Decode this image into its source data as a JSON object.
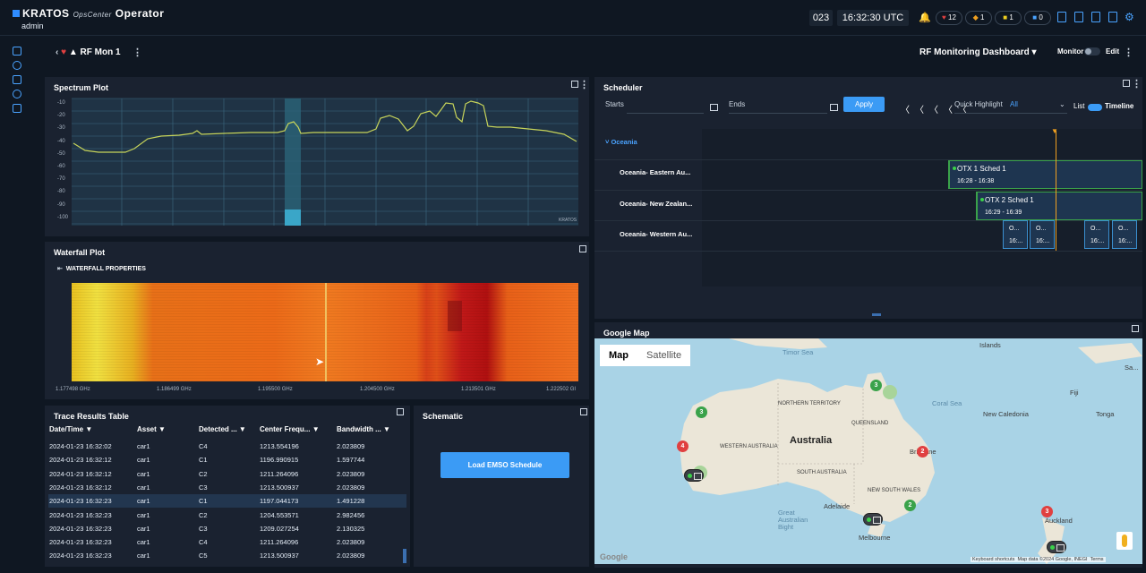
{
  "header": {
    "brand": "KRATOS",
    "product": "OpsCenter",
    "product_suffix": "Operator",
    "user": "admin",
    "counter": "023",
    "clock": "16:32:30 UTC",
    "alarms": [
      {
        "label": "12",
        "color": "#e04040"
      },
      {
        "label": "1",
        "color": "#f0a020"
      },
      {
        "label": "1",
        "color": "#f0d020"
      },
      {
        "label": "0",
        "color": "#4aa3ff"
      }
    ]
  },
  "subheader": {
    "breadcrumb": "RF Mon 1",
    "dashboard_select": "RF Monitoring Dashboard",
    "monitor_label": "Monitor",
    "edit_label": "Edit"
  },
  "spectrum": {
    "title": "Spectrum Plot",
    "y_ticks": [
      "-10",
      "-20",
      "-30",
      "-40",
      "-50",
      "-60",
      "-70",
      "-80",
      "-90",
      "-100",
      "-110",
      "-120"
    ],
    "watermark": "KRATOS"
  },
  "waterfall": {
    "title": "Waterfall Plot",
    "properties_label": "WATERFALL PROPERTIES",
    "x_ticks": [
      "1.177498 GHz",
      "1.186499 GHz",
      "1.195500 GHz",
      "1.204500 GHz",
      "1.213501 GHz",
      "1.222502 GI"
    ]
  },
  "trace_table": {
    "title": "Trace Results Table",
    "columns": [
      "Date/Time",
      "Asset",
      "Detected ...",
      "Center Frequ...",
      "Bandwidth ..."
    ],
    "rows": [
      [
        "2024-01-23 16:32:02",
        "car1",
        "C4",
        "1213.554196",
        "2.023809"
      ],
      [
        "2024-01-23 16:32:12",
        "car1",
        "C1",
        "1196.990915",
        "1.597744"
      ],
      [
        "2024-01-23 16:32:12",
        "car1",
        "C2",
        "1211.264096",
        "2.023809"
      ],
      [
        "2024-01-23 16:32:12",
        "car1",
        "C3",
        "1213.500937",
        "2.023809"
      ],
      [
        "2024-01-23 16:32:23",
        "car1",
        "C1",
        "1197.044173",
        "1.491228"
      ],
      [
        "2024-01-23 16:32:23",
        "car1",
        "C2",
        "1204.553571",
        "2.982456"
      ],
      [
        "2024-01-23 16:32:23",
        "car1",
        "C3",
        "1209.027254",
        "2.130325"
      ],
      [
        "2024-01-23 16:32:23",
        "car1",
        "C4",
        "1211.264096",
        "2.023809"
      ],
      [
        "2024-01-23 16:32:23",
        "car1",
        "C5",
        "1213.500937",
        "2.023809"
      ]
    ],
    "selected_row": 4
  },
  "schematic": {
    "title": "Schematic",
    "load_button": "Load EMSO Schedule"
  },
  "scheduler": {
    "title": "Scheduler",
    "starts_label": "Starts",
    "ends_label": "Ends",
    "apply_label": "Apply",
    "quick_highlight_label": "Quick Highlight",
    "quick_highlight_value": "All",
    "list_label": "List",
    "timeline_label": "Timeline",
    "group": "Oceania",
    "rows": [
      "Oceania- Eastern Au...",
      "Oceania- New Zealan...",
      "Oceania- Western Au..."
    ],
    "items": [
      {
        "name": "OTX 1 Sched 1",
        "time": "16:28 - 16:38"
      },
      {
        "name": "OTX 2 Sched 1",
        "time": "16:29 - 16:39"
      }
    ],
    "mini_items": [
      {
        "name": "O...",
        "time": "16:..."
      },
      {
        "name": "O...",
        "time": "16:..."
      },
      {
        "name": "O...",
        "time": "16:..."
      },
      {
        "name": "O...",
        "time": "16:..."
      }
    ]
  },
  "map": {
    "title": "Google Map",
    "tab_map": "Map",
    "tab_satellite": "Satellite",
    "places": [
      "Islands",
      "Timor Sea",
      "Coral Sea",
      "Fiji",
      "New Caledonia",
      "Tonga",
      "NORTHERN TERRITORY",
      "QUEENSLAND",
      "WESTERN AUSTRALIA",
      "Australia",
      "SOUTH AUSTRALIA",
      "NEW SOUTH WALES",
      "Brisbane",
      "Adelaide",
      "Melbourne",
      "Great Australian Bight",
      "Auckland",
      "Sa..."
    ],
    "clusters": [
      {
        "label": "3",
        "color": "#3aa24a"
      },
      {
        "label": "3",
        "color": "#3aa24a"
      },
      {
        "label": "4",
        "color": "#e04040"
      },
      {
        "label": "2",
        "color": "#e04040"
      },
      {
        "label": "2",
        "color": "#3aa24a"
      },
      {
        "label": "3",
        "color": "#e04040"
      }
    ],
    "footer": [
      "Keyboard shortcuts",
      "Map data ©2024 Google, INEGI",
      "Terms"
    ],
    "google": "Google"
  }
}
